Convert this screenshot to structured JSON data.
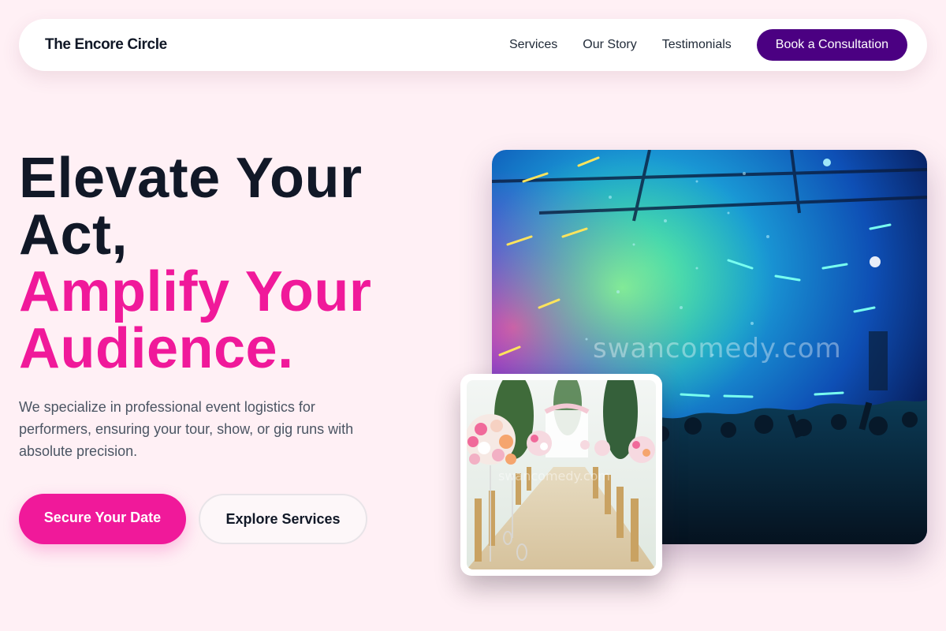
{
  "nav": {
    "brand": "The Encore Circle",
    "links": [
      "Services",
      "Our Story",
      "Testimonials"
    ],
    "cta": "Book a Consultation"
  },
  "hero": {
    "headline_dark_1": "Elevate Your",
    "headline_dark_2": "Act,",
    "headline_pink_1": "Amplify Your",
    "headline_pink_2": "Audience.",
    "description": "We specialize in professional event logistics for performers, ensuring your tour, show, or gig runs with absolute precision.",
    "primary_button": "Secure Your Date",
    "secondary_button": "Explore Services"
  },
  "images": {
    "watermark": "swancomedy.com",
    "watermark_small": "swancomedy.com"
  },
  "colors": {
    "background": "#fff0f5",
    "accent_pink": "#f0199a",
    "accent_purple": "#4b0082",
    "text_dark": "#111827"
  }
}
